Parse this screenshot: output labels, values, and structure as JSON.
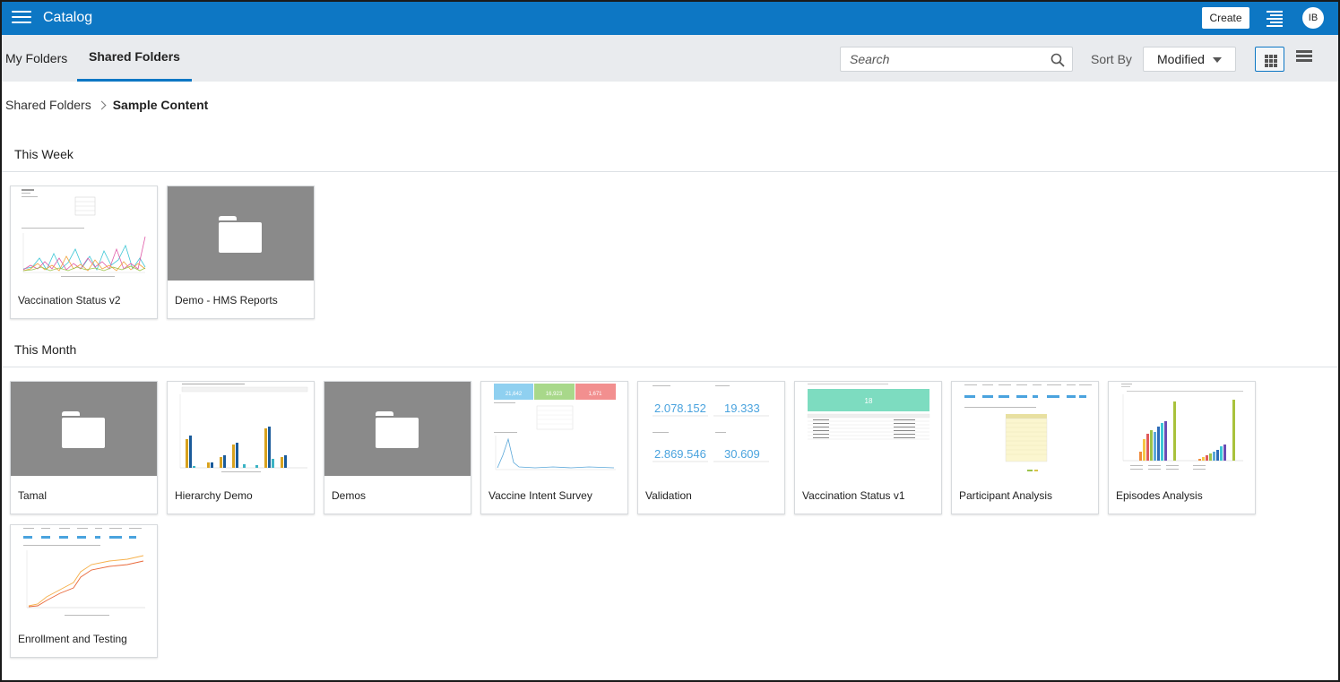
{
  "header": {
    "app_title": "Catalog",
    "create_label": "Create",
    "avatar_initials": "IB",
    "menu_icon": "hamburger-icon",
    "list_icon": "list-menu-icon"
  },
  "tabs": {
    "my_folders": "My Folders",
    "shared_folders": "Shared Folders",
    "active": "Shared Folders"
  },
  "toolbar": {
    "search_placeholder": "Search",
    "sort_by_label": "Sort By",
    "sort_value": "Modified",
    "view_mode": "grid"
  },
  "breadcrumb": {
    "parent": "Shared Folders",
    "current": "Sample Content"
  },
  "sections": {
    "this_week": {
      "title": "This Week",
      "items": [
        {
          "label": "Vaccination Status v2",
          "kind": "report"
        },
        {
          "label": "Demo - HMS Reports",
          "kind": "folder"
        }
      ]
    },
    "this_month": {
      "title": "This Month",
      "items": [
        {
          "label": "Tamal",
          "kind": "folder"
        },
        {
          "label": "Hierarchy Demo",
          "kind": "report"
        },
        {
          "label": "Demos",
          "kind": "folder"
        },
        {
          "label": "Vaccine Intent Survey",
          "kind": "report"
        },
        {
          "label": "Validation",
          "kind": "report"
        },
        {
          "label": "Vaccination Status v1",
          "kind": "report"
        },
        {
          "label": "Participant Analysis",
          "kind": "report"
        },
        {
          "label": "Episodes Analysis",
          "kind": "report"
        },
        {
          "label": "Enrollment and Testing",
          "kind": "report"
        }
      ]
    }
  },
  "thumbnails": {
    "vaccine_intent_tiles": [
      "21,642",
      "16,923",
      "1,671"
    ],
    "validation_values": [
      "2.078.152",
      "19.333",
      "2.869.546",
      "30.609"
    ],
    "vaccination_v1_banner": "18"
  },
  "colors": {
    "brand": "#0d77c4",
    "tab_bar": "#e9ebee",
    "folder_thumb": "#8a8a8a"
  }
}
